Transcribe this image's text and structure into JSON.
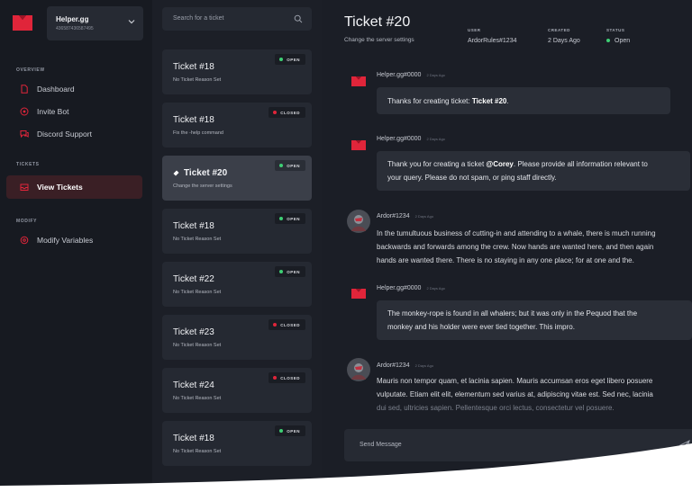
{
  "server": {
    "name": "Helper.gg",
    "id": "436587436587495"
  },
  "nav": {
    "overview_title": "OVERVIEW",
    "overview_items": [
      {
        "label": "Dashboard",
        "icon": "document-icon"
      },
      {
        "label": "Invite Bot",
        "icon": "target-icon"
      },
      {
        "label": "Discord Support",
        "icon": "chat-icon"
      }
    ],
    "tickets_title": "TICKETS",
    "tickets_items": [
      {
        "label": "View Tickets",
        "icon": "inbox-icon",
        "active": true
      }
    ],
    "modify_title": "MODIFY",
    "modify_items": [
      {
        "label": "Modify Variables",
        "icon": "settings-icon"
      }
    ]
  },
  "search": {
    "placeholder": "Search for a ticket"
  },
  "tickets": [
    {
      "title": "Ticket #18",
      "desc": "No Ticket Reason Set",
      "status": "OPEN"
    },
    {
      "title": "Ticket #18",
      "desc": "Fix the -help command",
      "status": "CLOSED"
    },
    {
      "title": "Ticket #20",
      "desc": "Change the server settings",
      "status": "OPEN",
      "selected": true
    },
    {
      "title": "Ticket #18",
      "desc": "No Ticket Reason Set",
      "status": "OPEN"
    },
    {
      "title": "Ticket #22",
      "desc": "No Ticket Reason Set",
      "status": "OPEN"
    },
    {
      "title": "Ticket #23",
      "desc": "No Ticket Reason Set",
      "status": "CLOSED"
    },
    {
      "title": "Ticket #24",
      "desc": "No Ticket Reason Set",
      "status": "CLOSED"
    },
    {
      "title": "Ticket #18",
      "desc": "No Ticket Reason Set",
      "status": "OPEN"
    }
  ],
  "colors": {
    "accent": "#e0253a",
    "open": "#3ecf74",
    "closed": "#e0253a"
  },
  "main": {
    "title": "Ticket #20",
    "subtitle": "Change the server settings",
    "user_label": "USER",
    "user_value": "ArdorRules#1234",
    "created_label": "CREATED",
    "created_value": "2 Days Ago",
    "status_label": "STATUS",
    "status_value": "Open"
  },
  "messages": [
    {
      "author": "Helper.gg#0000",
      "time": "2 Days Ago",
      "pre": "Thanks for creating ticket: ",
      "bold": "Ticket #20",
      "post": "."
    },
    {
      "author": "Helper.gg#0000",
      "time": "2 Days Ago",
      "line1_pre": "Thank you for creating a ticket ",
      "mention": "@Corey",
      "line1_post": ". Please provide all information relevant to",
      "line2": "your query. Please do not spam, or ping staff directly."
    },
    {
      "author": "Ardor#1234",
      "time": "2 Days Ago",
      "lines": [
        "In the tumultuous business of cutting-in and attending to a whale, there is much running",
        "backwards and forwards among the crew. Now hands are wanted here, and then again",
        "hands are wanted there. There is no staying in any one place; for at one and the."
      ]
    },
    {
      "author": "Helper.gg#0000",
      "time": "2 Days Ago",
      "lines": [
        "The monkey-rope is found in all whalers; but it was only in the Pequod that the",
        "monkey and his holder were ever tied together. This impro."
      ]
    },
    {
      "author": "Ardor#1234",
      "time": "2 Days Ago",
      "lines": [
        "Mauris non tempor quam, et lacinia sapien. Mauris accumsan eros eget libero posuere",
        "vulputate. Etiam elit elit, elementum sed varius at, adipiscing vitae est. Sed nec, lacinia",
        "dui sed, ultricies sapien. Pellentesque orci lectus, consectetur vel posuere."
      ]
    }
  ],
  "composer": {
    "placeholder": "Send Message"
  }
}
